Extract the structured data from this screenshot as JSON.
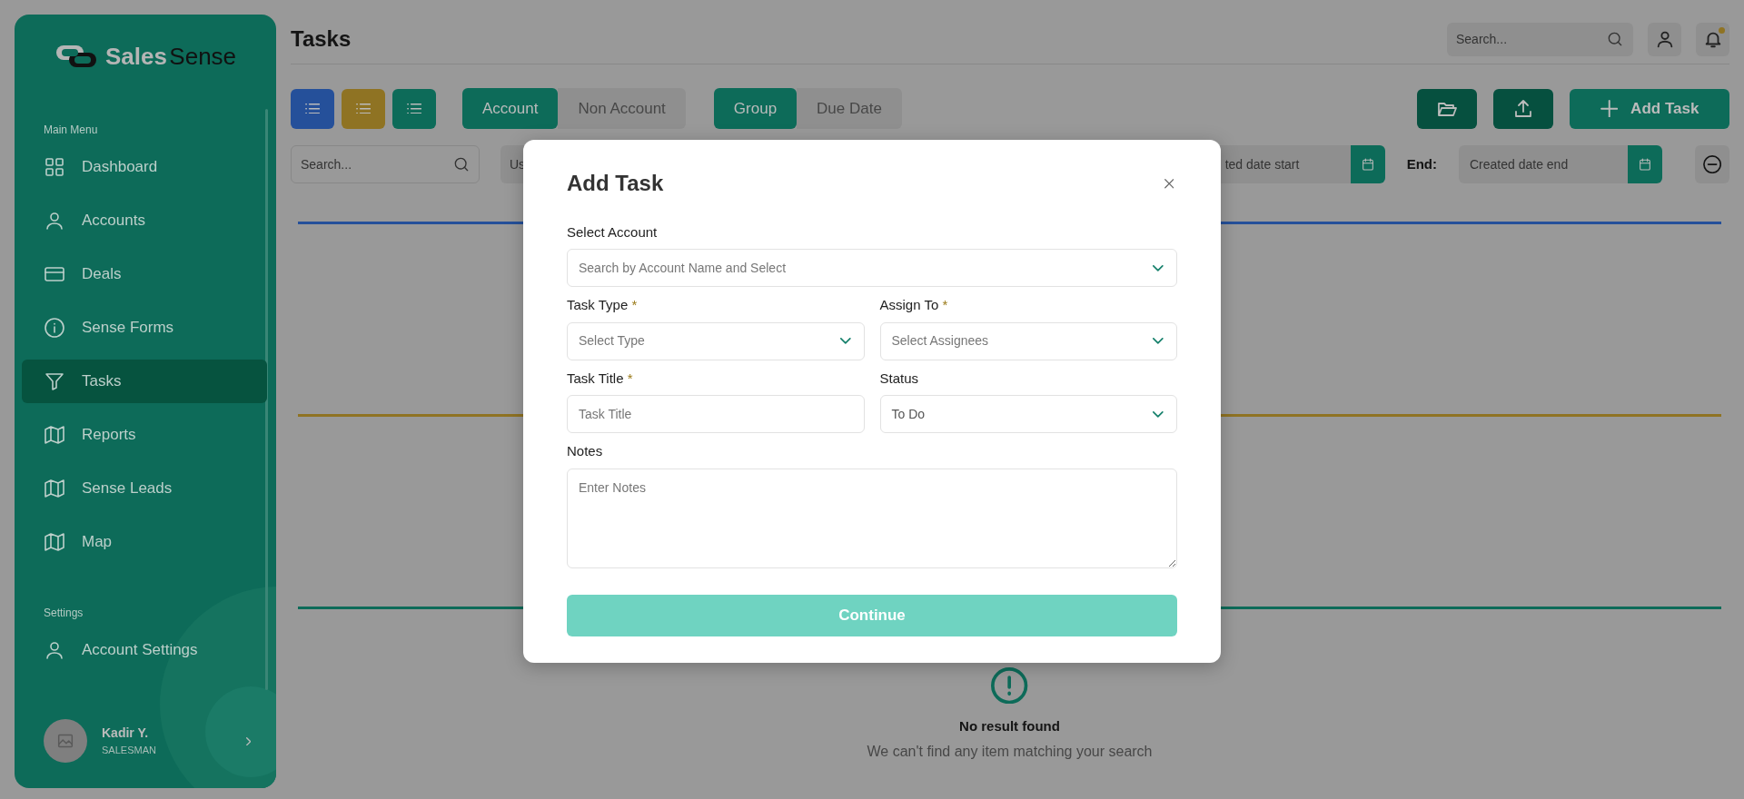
{
  "sidebar": {
    "logo": {
      "word_1": "Sales",
      "word_2": "Sense"
    },
    "sections": [
      {
        "heading": "Main Menu",
        "items": [
          {
            "label": "Dashboard",
            "kind": "grid",
            "selected": false
          },
          {
            "label": "Accounts",
            "kind": "person",
            "selected": false
          },
          {
            "label": "Deals",
            "kind": "card",
            "selected": false
          },
          {
            "label": "Sense Forms",
            "kind": "info",
            "selected": false
          },
          {
            "label": "Tasks",
            "kind": "filter",
            "selected": true
          },
          {
            "label": "Reports",
            "kind": "map",
            "selected": false
          },
          {
            "label": "Sense Leads",
            "kind": "map",
            "selected": false
          },
          {
            "label": "Map",
            "kind": "map",
            "selected": false
          }
        ]
      },
      {
        "heading": "Settings",
        "items": [
          {
            "label": "Account Settings",
            "kind": "person",
            "selected": false
          }
        ]
      }
    ],
    "user": {
      "name": "Kadir Y.",
      "role": "SALESMAN"
    }
  },
  "header": {
    "title": "Tasks",
    "search": {
      "placeholder": "Search..."
    },
    "notifications": {
      "unread": true
    }
  },
  "toolbar": {
    "view_buttons": [
      {
        "color": "#25509a"
      },
      {
        "color": "#8f7323"
      },
      {
        "color": "#0d6b59"
      }
    ],
    "account_toggle": [
      {
        "label": "Account",
        "selected": true
      },
      {
        "label": "Non Account",
        "selected": false
      }
    ],
    "group_toggle": [
      {
        "label": "Group",
        "selected": true
      },
      {
        "label": "Due Date",
        "selected": false
      }
    ],
    "actions": [
      {
        "kind": "folder"
      },
      {
        "kind": "upload"
      },
      {
        "kind": "add",
        "label": "Add Task"
      }
    ]
  },
  "filters": {
    "search": {
      "placeholder": "Search..."
    },
    "user_filter": {
      "placeholder": "Us"
    },
    "start_date": {
      "placeholder": "ted date start"
    },
    "end_label": "End:",
    "end_date": {
      "placeholder": "Created date end"
    }
  },
  "lanes": [
    {
      "color": "#25509a"
    },
    {
      "color": "#8f7323"
    },
    {
      "color": "#0d6b59"
    }
  ],
  "empty_state": {
    "title": "No result found",
    "message": "We can't find any item matching your search"
  },
  "modal": {
    "title": "Add Task",
    "rows": [
      [
        {
          "kind": "select",
          "label": "Select Account",
          "placeholder": "Search by Account Name and Select"
        }
      ],
      [
        {
          "kind": "select",
          "label": "Task Type",
          "required_mark": "*",
          "placeholder": "Select Type"
        },
        {
          "kind": "select",
          "label": "Assign To",
          "required_mark": "*",
          "placeholder": "Select Assignees"
        }
      ],
      [
        {
          "kind": "input",
          "label": "Task Title",
          "required_mark": "*",
          "placeholder": "Task Title"
        },
        {
          "kind": "select",
          "label": "Status",
          "value": "To Do"
        }
      ],
      [
        {
          "kind": "textarea",
          "label": "Notes",
          "placeholder": "Enter Notes"
        }
      ]
    ],
    "submit": {
      "label": "Continue",
      "disabled": true
    }
  }
}
